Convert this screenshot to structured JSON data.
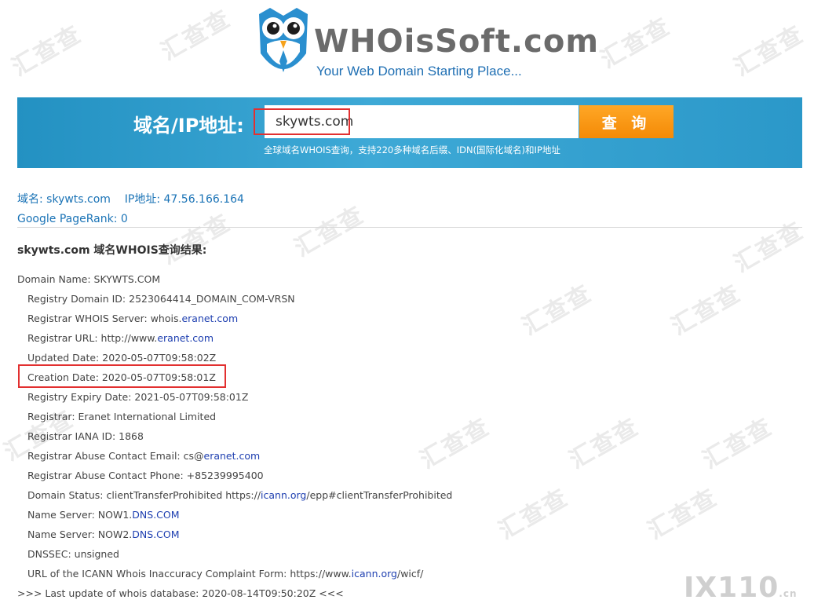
{
  "watermark": "汇查查",
  "logo": {
    "title": "WHOisSoft.com",
    "tagline": "Your Web Domain Starting Place..."
  },
  "search": {
    "label": "域名/IP地址:",
    "value": "skywts.com",
    "button": "查 询",
    "note": "全球域名WHOIS查询，支持220多种域名后缀、IDN(国际化域名)和IP地址"
  },
  "summary": {
    "domain_key": "域名:",
    "domain_value": "skywts.com",
    "ip_key": "IP地址:",
    "ip_value": "47.56.166.164",
    "pagerank": "Google PageRank: 0"
  },
  "result_title": "skywts.com 域名WHOIS查询结果:",
  "whois": {
    "domain_name": "Domain Name: SKYWTS.COM",
    "registry_domain_id": "Registry Domain ID: 2523064414_DOMAIN_COM-VRSN",
    "registrar_whois_server_prefix": "Registrar WHOIS Server: whois.",
    "registrar_whois_server_link": "eranet.com",
    "registrar_url_prefix": "Registrar URL: http://www.",
    "registrar_url_link": "eranet.com",
    "updated_date": "Updated Date: 2020-05-07T09:58:02Z",
    "creation_date": "Creation Date: 2020-05-07T09:58:01Z",
    "expiry_date": "Registry Expiry Date: 2021-05-07T09:58:01Z",
    "registrar": "Registrar: Eranet International Limited",
    "iana_id": "Registrar IANA ID: 1868",
    "abuse_email_prefix": "Registrar Abuse Contact Email: cs@",
    "abuse_email_link": "eranet.com",
    "abuse_phone": "Registrar Abuse Contact Phone: +85239995400",
    "status_prefix": "Domain Status: clientTransferProhibited https://",
    "status_link": "icann.org",
    "status_suffix": "/epp#clientTransferProhibited",
    "ns1_prefix": "Name Server: NOW1.",
    "ns1_link": "DNS.COM",
    "ns2_prefix": "Name Server: NOW2.",
    "ns2_link": "DNS.COM",
    "dnssec": "DNSSEC: unsigned",
    "icann_form_prefix": "URL of the ICANN Whois Inaccuracy Complaint Form: https://www.",
    "icann_form_link": "icann.org",
    "icann_form_suffix": "/wicf/",
    "last_update": ">>> Last update of whois database: 2020-08-14T09:50:20Z <<<"
  },
  "footer_logo": {
    "main": "IX110",
    "suffix": ".cn"
  },
  "colors": {
    "banner": "#2b98c9",
    "button": "#f48a06",
    "link": "#1e3fb0",
    "highlight": "#e23030"
  }
}
